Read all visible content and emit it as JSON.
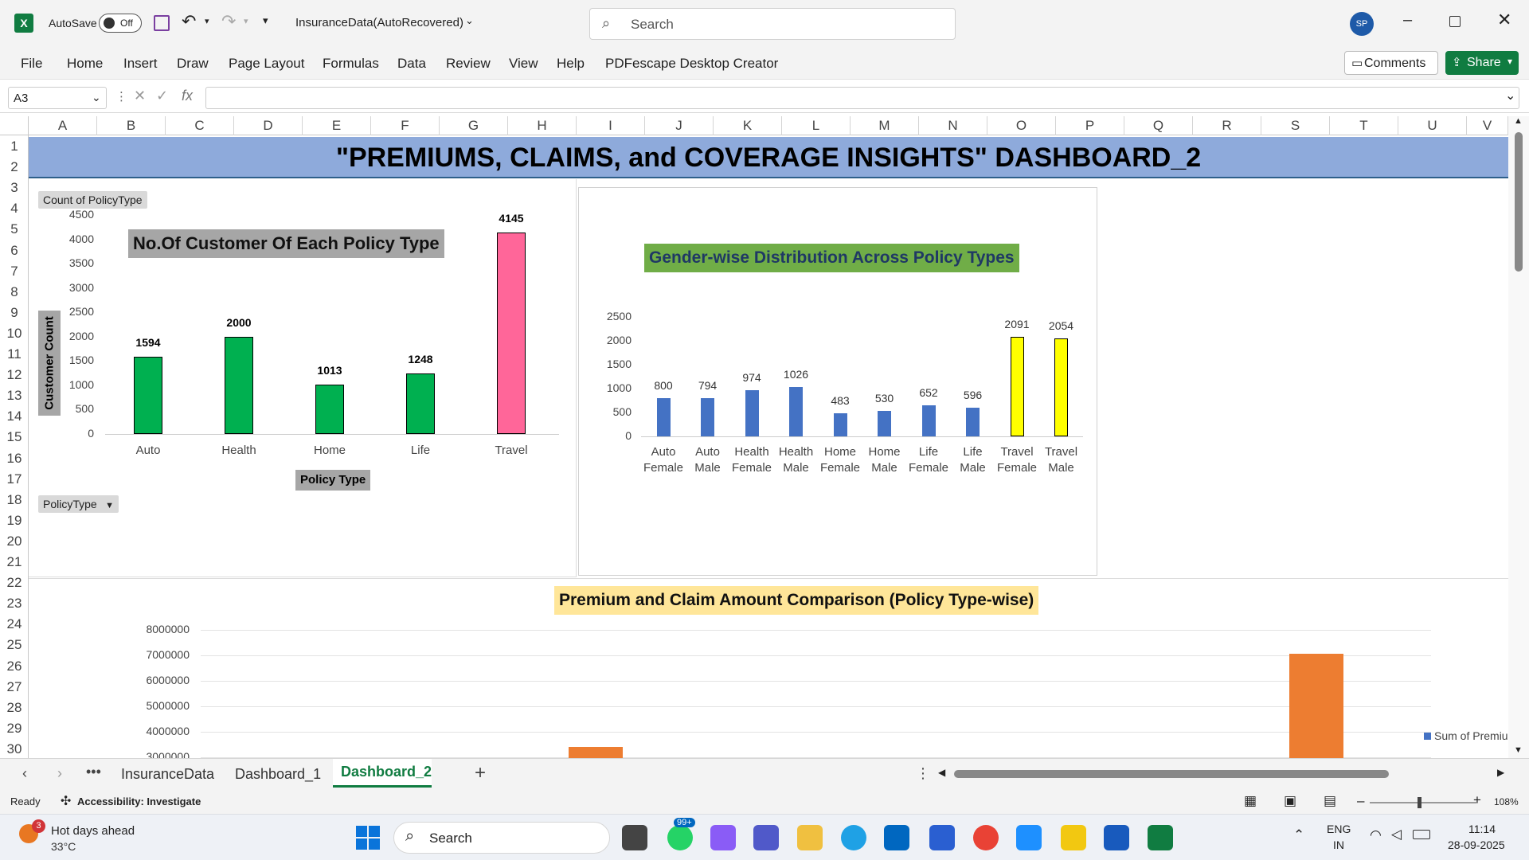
{
  "window": {
    "autosave_label": "AutoSave",
    "autosave_state": "Off",
    "file_title": "InsuranceData(AutoRecovered)",
    "search_placeholder": "Search",
    "user_initials": "SP"
  },
  "menu": {
    "items": [
      "File",
      "Home",
      "Insert",
      "Draw",
      "Page Layout",
      "Formulas",
      "Data",
      "Review",
      "View",
      "Help",
      "PDFescape Desktop Creator"
    ],
    "comments": "Comments",
    "share": "Share"
  },
  "formula_bar": {
    "name_box": "A3",
    "fx": "fx",
    "value": ""
  },
  "columns": [
    "A",
    "B",
    "C",
    "D",
    "E",
    "F",
    "G",
    "H",
    "I",
    "J",
    "K",
    "L",
    "M",
    "N",
    "O",
    "P",
    "Q",
    "R",
    "S",
    "T",
    "U",
    "V"
  ],
  "rows": [
    "1",
    "2",
    "3",
    "4",
    "5",
    "6",
    "7",
    "8",
    "9",
    "10",
    "11",
    "12",
    "13",
    "14",
    "15",
    "16",
    "17",
    "18",
    "19",
    "20",
    "21",
    "22",
    "23",
    "24",
    "25",
    "26",
    "27",
    "28",
    "29",
    "30"
  ],
  "dashboard": {
    "title": "\"PREMIUMS, CLAIMS, and COVERAGE INSIGHTS\"  DASHBOARD_2",
    "pivot_field_count": "Count of PolicyType",
    "pivot_field_policy": "PolicyType"
  },
  "colors": {
    "green": "#00b050",
    "pink": "#ff6699",
    "blue": "#4472c4",
    "yellow": "#ffff00",
    "orange": "#ed7d31",
    "title_band": "#8eaadb",
    "excel_green": "#107c41"
  },
  "chart_data": [
    {
      "type": "bar",
      "title": "No.Of Customer Of Each Policy Type",
      "xlabel": "Policy Type",
      "ylabel": "Customer Count",
      "categories": [
        "Auto",
        "Health",
        "Home",
        "Life",
        "Travel"
      ],
      "values": [
        1594,
        2000,
        1013,
        1248,
        4145
      ],
      "ylim": [
        0,
        4500
      ],
      "yticks": [
        "0",
        "500",
        "1000",
        "1500",
        "2000",
        "2500",
        "3000",
        "3500",
        "4000",
        "4500"
      ],
      "grid": false
    },
    {
      "type": "bar",
      "title": "Gender-wise Distribution Across Policy Types",
      "categories": [
        "Auto Female",
        "Auto Male",
        "Health Female",
        "Health Male",
        "Home Female",
        "Home Male",
        "Life Female",
        "Life Male",
        "Travel Female",
        "Travel Male"
      ],
      "values": [
        800,
        794,
        974,
        1026,
        483,
        530,
        652,
        596,
        2091,
        2054
      ],
      "ylim": [
        0,
        2500
      ],
      "yticks": [
        "0",
        "500",
        "1000",
        "1500",
        "2000",
        "2500"
      ],
      "grid": false
    },
    {
      "type": "bar",
      "title": "Premium and Claim Amount Comparison (Policy Type-wise)",
      "yticks": [
        "3000000",
        "4000000",
        "5000000",
        "6000000",
        "7000000",
        "8000000"
      ],
      "ylim": [
        0,
        8000000
      ],
      "visible_values": [
        3400000,
        7050000
      ],
      "legend": "Sum of Premiu",
      "grid": true
    }
  ],
  "sheet_tabs": [
    "InsuranceData",
    "Dashboard_1",
    "Dashboard_2"
  ],
  "active_tab": "Dashboard_2",
  "status": {
    "ready": "Ready",
    "accessibility": "Accessibility: Investigate",
    "zoom": "108%"
  },
  "taskbar": {
    "weather_title": "Hot days ahead",
    "weather_temp": "33°C",
    "weather_badge": "3",
    "search": "Search",
    "whatsapp_badge": "99+",
    "lang1": "ENG",
    "lang2": "IN",
    "time": "11:14",
    "date": "28-09-2025"
  }
}
